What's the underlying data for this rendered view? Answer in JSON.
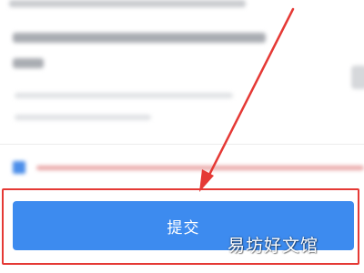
{
  "form": {
    "submit_label": "提交",
    "agree_checked": true
  },
  "annotation": {
    "highlight_color": "#e53935",
    "arrow_color": "#e53935"
  },
  "colors": {
    "button_bg": "#3d8bef",
    "checkbox": "#4c8eea",
    "agree_text_tint": "#e9a6a6"
  },
  "watermark": {
    "text": "易坊好文馆"
  }
}
